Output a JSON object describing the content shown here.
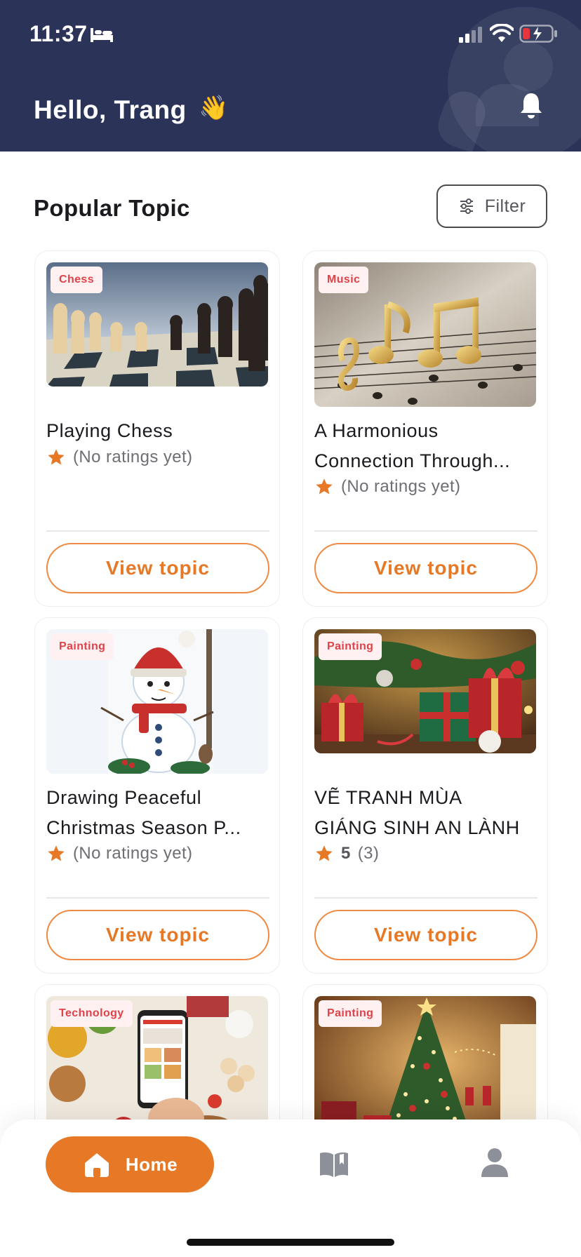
{
  "status_bar": {
    "time": "11:37"
  },
  "header": {
    "greeting": "Hello, Trang",
    "emoji": "👋"
  },
  "section": {
    "title": "Popular Topic",
    "filter_label": "Filter"
  },
  "topics": [
    {
      "category": "Chess",
      "title": "Playing Chess",
      "rating_text": "(No ratings yet)",
      "button": "View topic"
    },
    {
      "category": "Music",
      "title_line1": "A Harmonious",
      "title_line2": "Connection Through...",
      "rating_text": "(No ratings yet)",
      "button": "View topic"
    },
    {
      "category": "Painting",
      "title_line1": "Drawing Peaceful",
      "title_line2": "Christmas Season P...",
      "rating_text": "(No ratings yet)",
      "button": "View topic"
    },
    {
      "category": "Painting",
      "title_line1": "VẼ TRANH MÙA",
      "title_line2": "GIÁNG SINH AN LÀNH",
      "rating_score": "5",
      "rating_count": "(3)",
      "button": "View topic"
    },
    {
      "category": "Technology"
    },
    {
      "category": "Painting"
    }
  ],
  "nav": {
    "home_label": "Home",
    "active": "home"
  },
  "colors": {
    "header_bg": "#2b3358",
    "accent": "#e67826",
    "badge_text": "#e0424a",
    "badge_bg": "#fff1f1",
    "star": "#e67826"
  }
}
